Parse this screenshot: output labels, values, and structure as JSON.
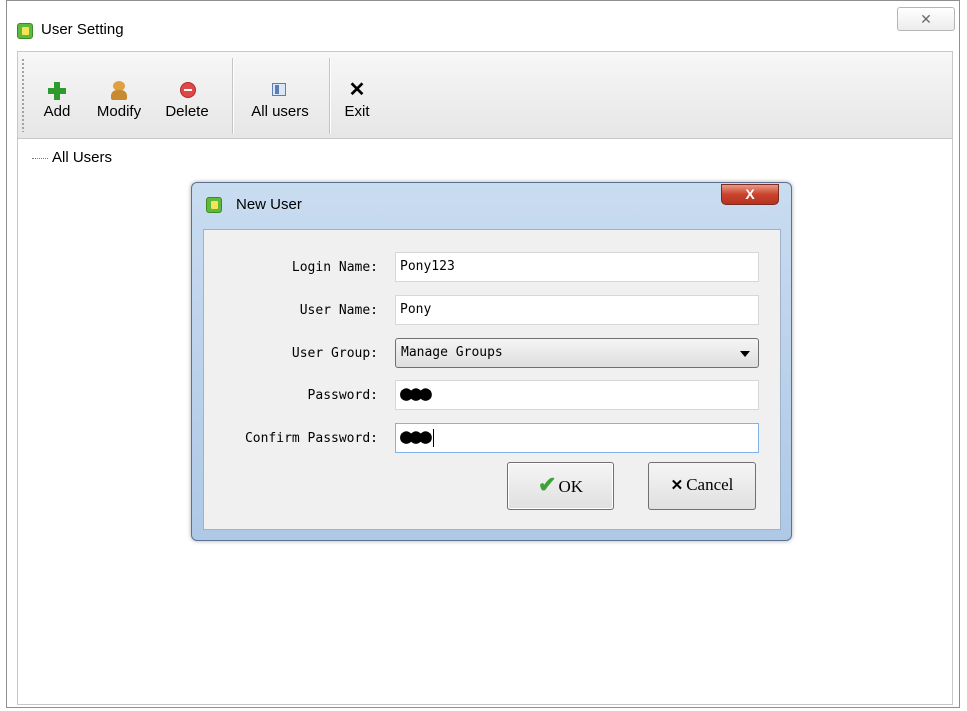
{
  "window": {
    "title": "User Setting",
    "close_symbol": "✕"
  },
  "toolbar": {
    "add_label": "Add",
    "modify_label": "Modify",
    "delete_label": "Delete",
    "all_users_label": "All users",
    "exit_label": "Exit"
  },
  "tree": {
    "root_label": "All Users"
  },
  "dialog": {
    "title": "New User",
    "close_symbol": "X",
    "fields": {
      "login_name_label": "Login Name:",
      "login_name_value": "Pony123",
      "user_name_label": "User Name:",
      "user_name_value": "Pony",
      "user_group_label": "User Group:",
      "user_group_value": "Manage Groups",
      "password_label": "Password:",
      "password_value": "●●●",
      "confirm_password_label": "Confirm Password:",
      "confirm_password_value": "●●●"
    },
    "ok_label": "OK",
    "cancel_label": "Cancel"
  },
  "icons": {
    "app": "app-icon",
    "add": "plus-icon",
    "modify": "user-edit-icon",
    "delete": "delete-icon",
    "all_users": "users-list-icon",
    "exit": "close-icon",
    "ok": "checkmark-icon",
    "cancel": "x-icon"
  },
  "colors": {
    "add_green": "#2f9a2f",
    "delete_red": "#e04848",
    "dialog_close_red": "#c9432c",
    "dialog_frame": "#aec8e6"
  }
}
